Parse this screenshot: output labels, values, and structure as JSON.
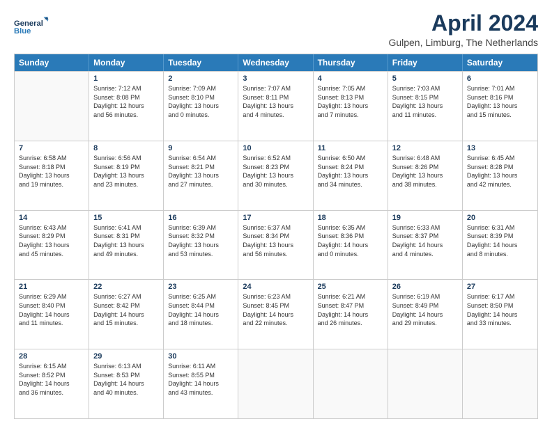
{
  "logo": {
    "line1": "General",
    "line2": "Blue"
  },
  "title": "April 2024",
  "subtitle": "Gulpen, Limburg, The Netherlands",
  "header_days": [
    "Sunday",
    "Monday",
    "Tuesday",
    "Wednesday",
    "Thursday",
    "Friday",
    "Saturday"
  ],
  "weeks": [
    [
      {
        "day": "",
        "info": ""
      },
      {
        "day": "1",
        "info": "Sunrise: 7:12 AM\nSunset: 8:08 PM\nDaylight: 12 hours\nand 56 minutes."
      },
      {
        "day": "2",
        "info": "Sunrise: 7:09 AM\nSunset: 8:10 PM\nDaylight: 13 hours\nand 0 minutes."
      },
      {
        "day": "3",
        "info": "Sunrise: 7:07 AM\nSunset: 8:11 PM\nDaylight: 13 hours\nand 4 minutes."
      },
      {
        "day": "4",
        "info": "Sunrise: 7:05 AM\nSunset: 8:13 PM\nDaylight: 13 hours\nand 7 minutes."
      },
      {
        "day": "5",
        "info": "Sunrise: 7:03 AM\nSunset: 8:15 PM\nDaylight: 13 hours\nand 11 minutes."
      },
      {
        "day": "6",
        "info": "Sunrise: 7:01 AM\nSunset: 8:16 PM\nDaylight: 13 hours\nand 15 minutes."
      }
    ],
    [
      {
        "day": "7",
        "info": "Sunrise: 6:58 AM\nSunset: 8:18 PM\nDaylight: 13 hours\nand 19 minutes."
      },
      {
        "day": "8",
        "info": "Sunrise: 6:56 AM\nSunset: 8:19 PM\nDaylight: 13 hours\nand 23 minutes."
      },
      {
        "day": "9",
        "info": "Sunrise: 6:54 AM\nSunset: 8:21 PM\nDaylight: 13 hours\nand 27 minutes."
      },
      {
        "day": "10",
        "info": "Sunrise: 6:52 AM\nSunset: 8:23 PM\nDaylight: 13 hours\nand 30 minutes."
      },
      {
        "day": "11",
        "info": "Sunrise: 6:50 AM\nSunset: 8:24 PM\nDaylight: 13 hours\nand 34 minutes."
      },
      {
        "day": "12",
        "info": "Sunrise: 6:48 AM\nSunset: 8:26 PM\nDaylight: 13 hours\nand 38 minutes."
      },
      {
        "day": "13",
        "info": "Sunrise: 6:45 AM\nSunset: 8:28 PM\nDaylight: 13 hours\nand 42 minutes."
      }
    ],
    [
      {
        "day": "14",
        "info": "Sunrise: 6:43 AM\nSunset: 8:29 PM\nDaylight: 13 hours\nand 45 minutes."
      },
      {
        "day": "15",
        "info": "Sunrise: 6:41 AM\nSunset: 8:31 PM\nDaylight: 13 hours\nand 49 minutes."
      },
      {
        "day": "16",
        "info": "Sunrise: 6:39 AM\nSunset: 8:32 PM\nDaylight: 13 hours\nand 53 minutes."
      },
      {
        "day": "17",
        "info": "Sunrise: 6:37 AM\nSunset: 8:34 PM\nDaylight: 13 hours\nand 56 minutes."
      },
      {
        "day": "18",
        "info": "Sunrise: 6:35 AM\nSunset: 8:36 PM\nDaylight: 14 hours\nand 0 minutes."
      },
      {
        "day": "19",
        "info": "Sunrise: 6:33 AM\nSunset: 8:37 PM\nDaylight: 14 hours\nand 4 minutes."
      },
      {
        "day": "20",
        "info": "Sunrise: 6:31 AM\nSunset: 8:39 PM\nDaylight: 14 hours\nand 8 minutes."
      }
    ],
    [
      {
        "day": "21",
        "info": "Sunrise: 6:29 AM\nSunset: 8:40 PM\nDaylight: 14 hours\nand 11 minutes."
      },
      {
        "day": "22",
        "info": "Sunrise: 6:27 AM\nSunset: 8:42 PM\nDaylight: 14 hours\nand 15 minutes."
      },
      {
        "day": "23",
        "info": "Sunrise: 6:25 AM\nSunset: 8:44 PM\nDaylight: 14 hours\nand 18 minutes."
      },
      {
        "day": "24",
        "info": "Sunrise: 6:23 AM\nSunset: 8:45 PM\nDaylight: 14 hours\nand 22 minutes."
      },
      {
        "day": "25",
        "info": "Sunrise: 6:21 AM\nSunset: 8:47 PM\nDaylight: 14 hours\nand 26 minutes."
      },
      {
        "day": "26",
        "info": "Sunrise: 6:19 AM\nSunset: 8:49 PM\nDaylight: 14 hours\nand 29 minutes."
      },
      {
        "day": "27",
        "info": "Sunrise: 6:17 AM\nSunset: 8:50 PM\nDaylight: 14 hours\nand 33 minutes."
      }
    ],
    [
      {
        "day": "28",
        "info": "Sunrise: 6:15 AM\nSunset: 8:52 PM\nDaylight: 14 hours\nand 36 minutes."
      },
      {
        "day": "29",
        "info": "Sunrise: 6:13 AM\nSunset: 8:53 PM\nDaylight: 14 hours\nand 40 minutes."
      },
      {
        "day": "30",
        "info": "Sunrise: 6:11 AM\nSunset: 8:55 PM\nDaylight: 14 hours\nand 43 minutes."
      },
      {
        "day": "",
        "info": ""
      },
      {
        "day": "",
        "info": ""
      },
      {
        "day": "",
        "info": ""
      },
      {
        "day": "",
        "info": ""
      }
    ]
  ]
}
